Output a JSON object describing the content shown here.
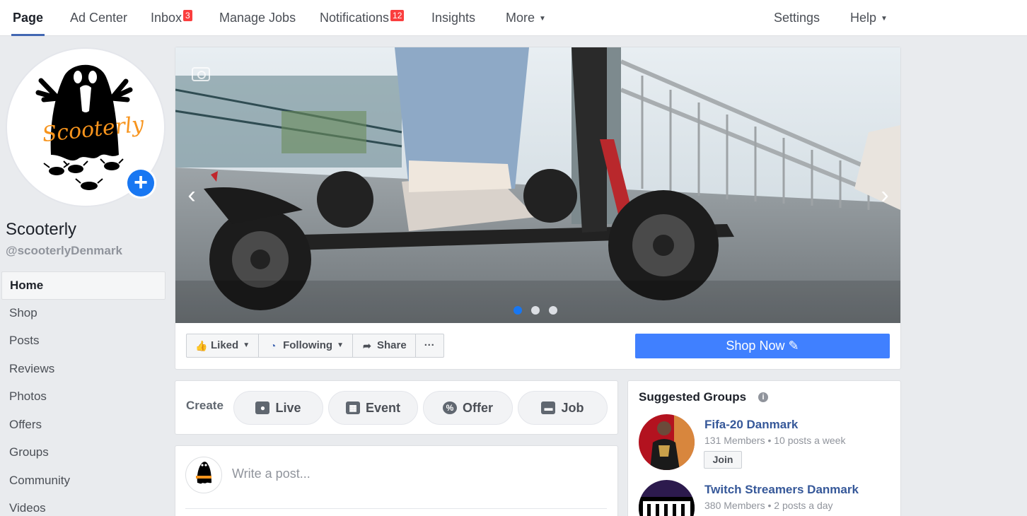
{
  "nav": {
    "page": "Page",
    "ad_center": "Ad Center",
    "inbox": "Inbox",
    "inbox_count": "3",
    "manage_jobs": "Manage Jobs",
    "notifications": "Notifications",
    "notifications_count": "12",
    "insights": "Insights",
    "more": "More",
    "settings": "Settings",
    "help": "Help"
  },
  "profile": {
    "name": "Scooterly",
    "handle": "@scooterlyDenmark",
    "logo_text": "Scooterly"
  },
  "sidebar": {
    "items": [
      {
        "label": "Home"
      },
      {
        "label": "Shop"
      },
      {
        "label": "Posts"
      },
      {
        "label": "Reviews"
      },
      {
        "label": "Photos"
      },
      {
        "label": "Offers"
      },
      {
        "label": "Groups"
      },
      {
        "label": "Community"
      },
      {
        "label": "Videos"
      }
    ]
  },
  "cover": {
    "slide_count": 3,
    "active_slide": 1
  },
  "actions": {
    "liked": "Liked",
    "following": "Following",
    "share": "Share",
    "more": "···",
    "shop_now": "Shop Now"
  },
  "create": {
    "label": "Create",
    "live": "Live",
    "event": "Event",
    "offer": "Offer",
    "job": "Job"
  },
  "post": {
    "placeholder": "Write a post..."
  },
  "groups": {
    "title": "Suggested Groups",
    "join": "Join",
    "items": [
      {
        "name": "Fifa-20 Danmark",
        "meta": "131 Members • 10 posts a week"
      },
      {
        "name": "Twitch Streamers Danmark",
        "meta": "380 Members • 2 posts a day"
      }
    ]
  },
  "colors": {
    "accent": "#4267b2",
    "shop_now": "#4080ff",
    "badge": "#fa3e3e",
    "logo_orange": "#f7941d"
  }
}
